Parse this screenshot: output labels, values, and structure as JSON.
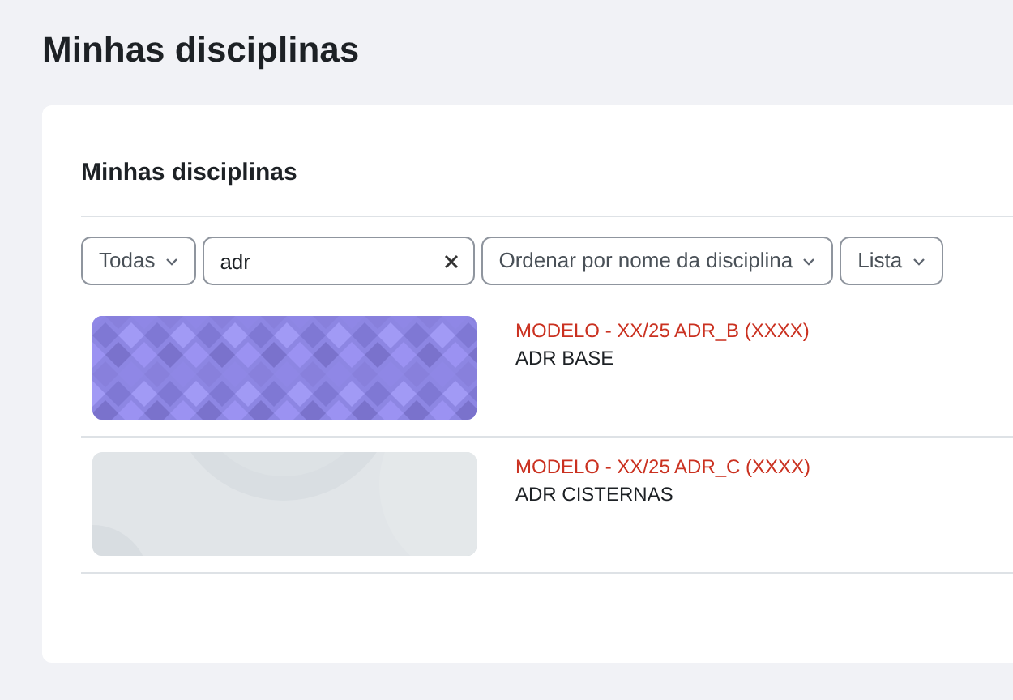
{
  "page_title": "Minhas disciplinas",
  "card_title": "Minhas disciplinas",
  "filters": {
    "grouping": "Todas",
    "search": {
      "value": "adr"
    },
    "sort": "Ordenar por nome da disciplina",
    "view": "Lista"
  },
  "courses": [
    {
      "category": "MODELO - XX/25 ADR_B (XXXX)",
      "name": "ADR BASE",
      "kind": "squares"
    },
    {
      "category": "MODELO - XX/25 ADR_C (XXXX)",
      "name": "ADR CISTERNAS",
      "kind": "circles"
    }
  ]
}
